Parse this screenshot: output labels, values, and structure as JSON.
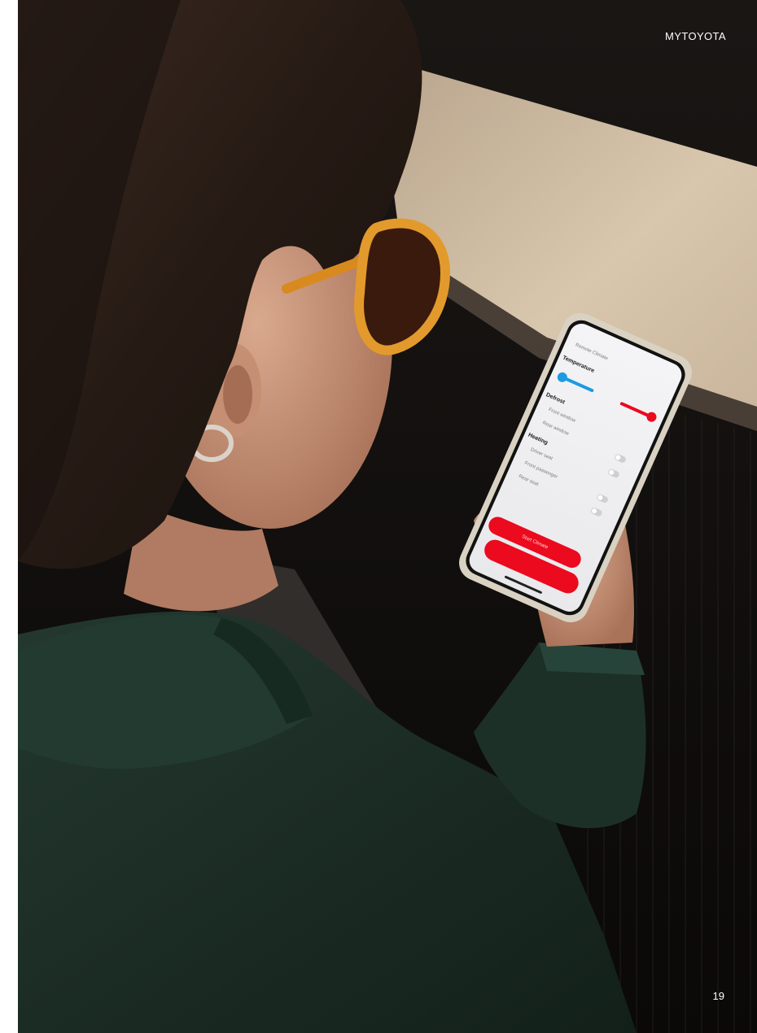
{
  "header": {
    "brand": "MYTOYOTA"
  },
  "footer": {
    "page_number": "19"
  },
  "photo": {
    "description_icon": "woman-using-phone-photo",
    "phone_app": {
      "title": "Remote Climate",
      "sections": {
        "temperature": "Temperature",
        "defrost": "Defrost",
        "heating": "Heating"
      },
      "items": [
        "Front window",
        "Rear window",
        "Driver seat",
        "Front passenger",
        "Rear seat"
      ],
      "cta": "Start Climate"
    },
    "colors": {
      "accent_red": "#eb0a1e",
      "accent_blue": "#1e9be0",
      "jacket": "#1d2e27",
      "hair": "#2a1d17",
      "glasses": "#d98a1e"
    }
  }
}
